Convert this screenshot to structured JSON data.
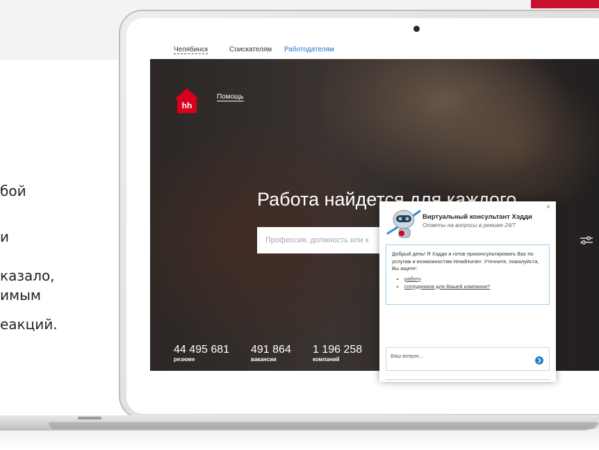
{
  "slide": {
    "side_lines": [
      "бой",
      "и",
      "казало,",
      "имым",
      "еакций."
    ]
  },
  "site": {
    "city": "Челябинск",
    "nav_seekers": "Соискателям",
    "nav_employers": "Работодателям",
    "logo_text": "hh",
    "help_link": "Помощь",
    "headline": "Работа найдется для каждого",
    "search_placeholder": "Профессия, должность или к",
    "stats": [
      {
        "value": "44 495 681",
        "label": "резюме"
      },
      {
        "value": "491 864",
        "label": "вакансии"
      },
      {
        "value": "1 196 258",
        "label": "компаний"
      }
    ]
  },
  "chat": {
    "title": "Виртуальный консультант Хэдди",
    "subtitle": "Ответы на вопросы в режиме 24/7",
    "close": "×",
    "message": "Добрый день! Я Хэдди и готов проконсультировать Вас по услугам и возможностям HeadHunter. Уточните, пожалуйста, Вы ищете:",
    "options": [
      "работу",
      "сотрудников для Вашей компании?"
    ],
    "input_placeholder": "Ваш вопрос..."
  },
  "colors": {
    "brand_red": "#d6001c",
    "link_blue": "#1a6fd0",
    "send_blue": "#1f7fc4",
    "chat_border": "#9fd0ec"
  }
}
